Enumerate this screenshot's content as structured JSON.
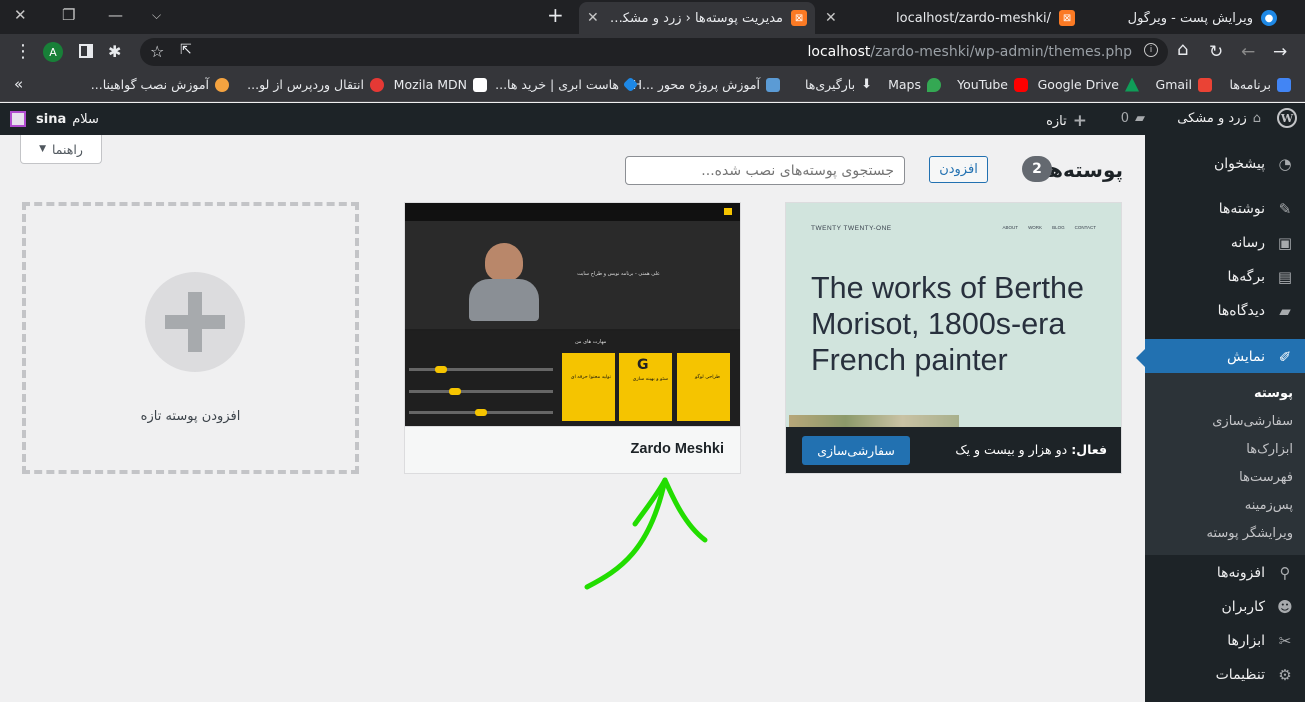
{
  "browser": {
    "tabs": [
      {
        "title": "ویرایش پست - ویرگول",
        "active": false
      },
      {
        "title": "localhost/zardo-meshki/",
        "active": false
      },
      {
        "title": "مدیریت پوسته‌ها ‹ زرد و مشکی —",
        "active": true
      }
    ],
    "url_host": "localhost",
    "url_path": "/zardo-meshki/wp-admin/themes.php",
    "profile_initial": "A",
    "bookmarks": [
      {
        "label": "برنامه‌ها",
        "icon": "apps-icon",
        "color": "#4285f4"
      },
      {
        "label": "Gmail",
        "icon": "gmail-icon",
        "color": "#ea4335"
      },
      {
        "label": "Google Drive",
        "icon": "drive-icon",
        "color": "#0f9d58"
      },
      {
        "label": "YouTube",
        "icon": "youtube-icon",
        "color": "#ff0000"
      },
      {
        "label": "Maps",
        "icon": "maps-icon",
        "color": "#34a853"
      },
      {
        "label": "بارگیری‌ها",
        "icon": "download-icon",
        "color": "#e8eaed"
      },
      {
        "label": "آموزش پروژه محور ...H",
        "icon": "site-icon",
        "color": "#5b9bd5"
      },
      {
        "label": "هاست ابری | خرید ها...",
        "icon": "cloud-icon",
        "color": "#1e88e5"
      },
      {
        "label": "Mozila MDN",
        "icon": "mdn-icon",
        "color": "#ffffff"
      },
      {
        "label": "انتقال وردپرس از لو...",
        "icon": "wp-icon",
        "color": "#e53935"
      },
      {
        "label": "آموزش نصب گواهینا...",
        "icon": "cert-icon",
        "color": "#f4a340"
      }
    ],
    "bookmarks_overflow": "»"
  },
  "adminbar": {
    "site_name": "زرد و مشکی",
    "comments_count": "0",
    "new_label": "تازه",
    "greeting": "سلام",
    "user": "sina"
  },
  "sidebar": {
    "items": [
      {
        "label": "پیشخوان",
        "icon": "dashboard-icon"
      },
      {
        "label": "نوشته‌ها",
        "icon": "pin-icon"
      },
      {
        "label": "رسانه",
        "icon": "media-icon"
      },
      {
        "label": "برگه‌ها",
        "icon": "pages-icon"
      },
      {
        "label": "دیدگاه‌ها",
        "icon": "comments-icon"
      },
      {
        "label": "نمایش",
        "icon": "appearance-icon"
      },
      {
        "label": "افزونه‌ها",
        "icon": "plugins-icon"
      },
      {
        "label": "کاربران",
        "icon": "users-icon"
      },
      {
        "label": "ابزارها",
        "icon": "tools-icon"
      },
      {
        "label": "تنظیمات",
        "icon": "settings-icon"
      }
    ],
    "submenu": [
      "پوسته",
      "سفارشی‌سازی",
      "ابزارک‌ها",
      "فهرست‌ها",
      "پس‌زمینه",
      "ویرایشگر پوسته"
    ]
  },
  "page": {
    "help_label": "راهنما",
    "title": "پوسته‌ها",
    "theme_count": "2",
    "add_button": "افزودن",
    "search_placeholder": "جستجوی پوسته‌های نصب شده..."
  },
  "themes": {
    "active": {
      "brand": "TWENTY TWENTY-ONE",
      "nav": [
        "ABOUT",
        "WORK",
        "BLOG",
        "CONTACT"
      ],
      "headline": "The works of Berthe Morisot, 1800s-era French painter",
      "active_prefix": "فعال:",
      "active_name": "دو هزار و بیست و یک",
      "customize_button": "سفارشی‌سازی"
    },
    "second": {
      "name": "Zardo Meshki",
      "preview_heading": "علی همتی - برنامه نویس و طراح سایت",
      "preview_section": "مهارت های من",
      "preview_boxes": [
        "طراحی لوگو",
        "سئو و بهینه سازی",
        "تولید محتوا حرفه ای"
      ]
    },
    "add_new_label": "افزودن پوسته تازه"
  },
  "colors": {
    "wp_blue": "#2271b1",
    "admin_dark": "#1d2327",
    "annotation_green": "#22dd00",
    "zardo_yellow": "#f5c400"
  }
}
